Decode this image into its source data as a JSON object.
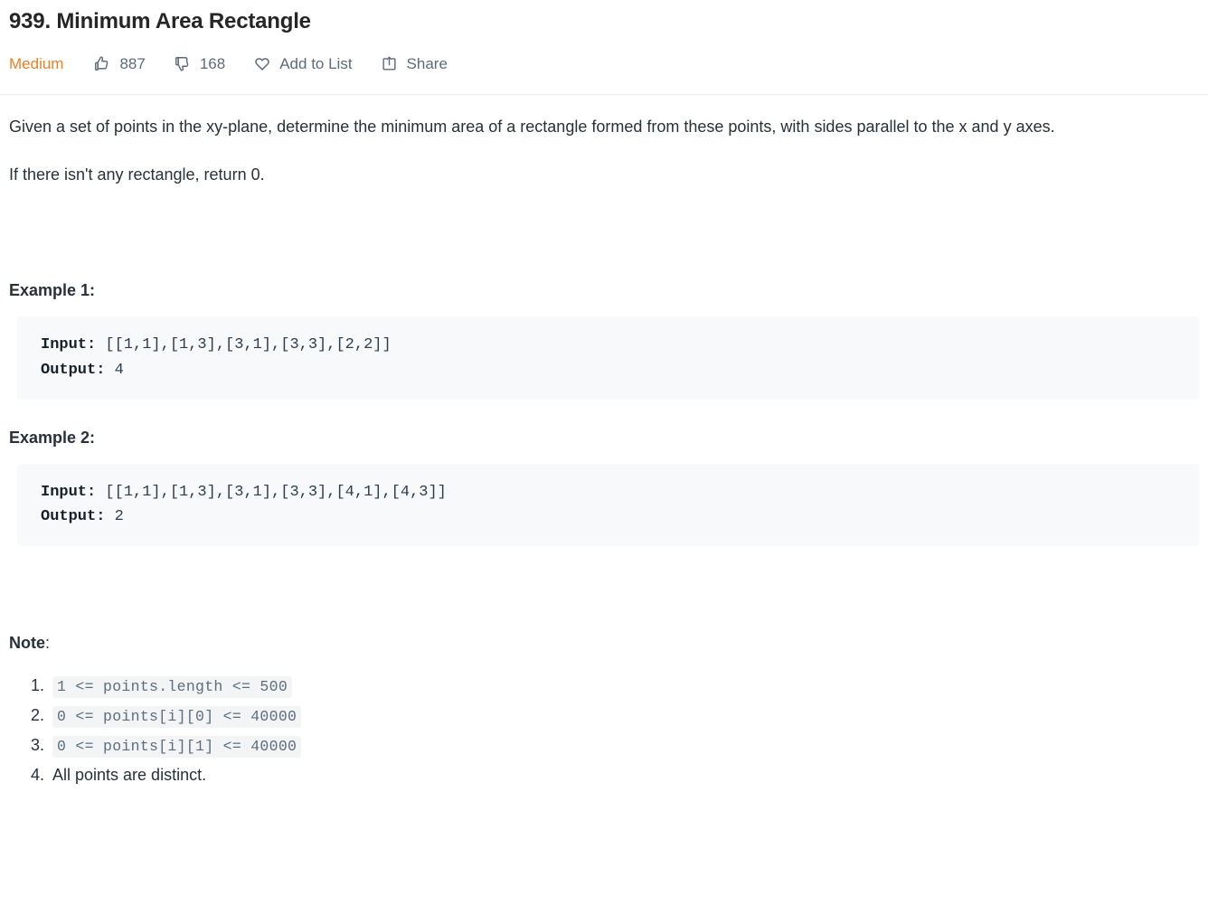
{
  "problem": {
    "title": "939. Minimum Area Rectangle",
    "difficulty": "Medium"
  },
  "actions": {
    "likes": "887",
    "dislikes": "168",
    "add_to_list": "Add to List",
    "share": "Share"
  },
  "description": {
    "paragraph1": "Given a set of points in the xy-plane, determine the minimum area of a rectangle formed from these points, with sides parallel to the x and y axes.",
    "paragraph2": "If there isn't any rectangle, return 0."
  },
  "examples": [
    {
      "heading": "Example 1:",
      "input_label": "Input:",
      "input_value": " [[1,1],[1,3],[3,1],[3,3],[2,2]]",
      "output_label": "Output:",
      "output_value": " 4"
    },
    {
      "heading": "Example 2:",
      "input_label": "Input:",
      "input_value": " [[1,1],[1,3],[3,1],[3,3],[4,1],[4,3]]",
      "output_label": "Output:",
      "output_value": " 2"
    }
  ],
  "note": {
    "heading": "Note",
    "heading_colon": ":",
    "items": [
      "1 <= points.length <= 500",
      "0 <= points[i][0] <= 40000",
      "0 <= points[i][1] <= 40000",
      "All points are distinct."
    ]
  },
  "colors": {
    "difficulty_medium": "#ef7e22",
    "text_primary": "#263238",
    "meta_text": "#5c6b7a",
    "code_background": "#f7f9fa",
    "inline_code_background": "#f2f4f6",
    "inline_code_text": "#5d6d7e",
    "divider": "#ebeced"
  },
  "icons": {
    "like": "thumbs-up-icon",
    "dislike": "thumbs-down-icon",
    "add_to_list": "heart-icon",
    "share": "share-icon"
  }
}
